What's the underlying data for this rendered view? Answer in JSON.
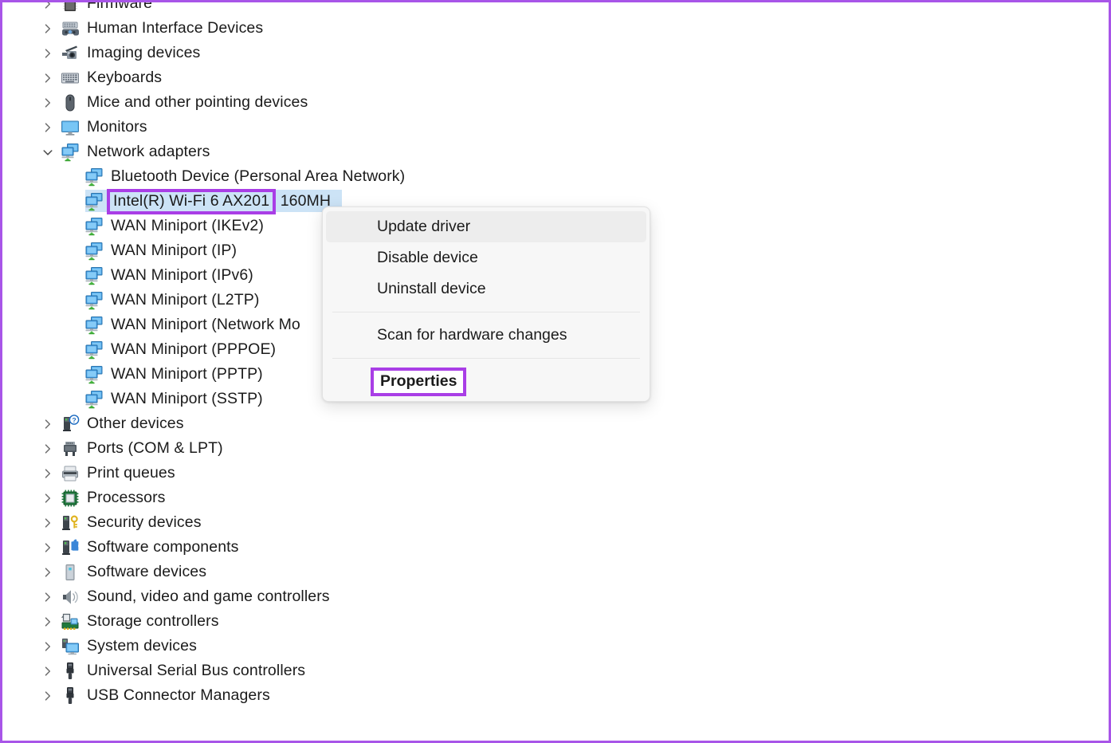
{
  "window": {
    "app": "Device Manager",
    "accent_purple": "#a93ee6",
    "selection_blue": "#cce3f6"
  },
  "tree": {
    "items": [
      {
        "label": "Firmware",
        "level": 1,
        "chevron": "right",
        "icon": "firmware-icon",
        "selected": false
      },
      {
        "label": "Human Interface Devices",
        "level": 1,
        "chevron": "right",
        "icon": "hid-icon",
        "selected": false
      },
      {
        "label": "Imaging devices",
        "level": 1,
        "chevron": "right",
        "icon": "camera-icon",
        "selected": false
      },
      {
        "label": "Keyboards",
        "level": 1,
        "chevron": "right",
        "icon": "keyboard-icon",
        "selected": false
      },
      {
        "label": "Mice and other pointing devices",
        "level": 1,
        "chevron": "right",
        "icon": "mouse-icon",
        "selected": false
      },
      {
        "label": "Monitors",
        "level": 1,
        "chevron": "right",
        "icon": "monitor-icon",
        "selected": false
      },
      {
        "label": "Network adapters",
        "level": 1,
        "chevron": "down",
        "icon": "network-adapter-icon",
        "selected": false
      },
      {
        "label": "Bluetooth Device (Personal Area Network)",
        "level": 2,
        "chevron": "none",
        "icon": "network-adapter-icon",
        "selected": false
      },
      {
        "label": "Intel(R) Wi-Fi 6 AX201",
        "label_tail": " 160MH",
        "level": 2,
        "chevron": "none",
        "icon": "network-adapter-icon",
        "selected": true,
        "boxed": true
      },
      {
        "label": "WAN Miniport (IKEv2)",
        "level": 2,
        "chevron": "none",
        "icon": "network-adapter-icon",
        "selected": false
      },
      {
        "label": "WAN Miniport (IP)",
        "level": 2,
        "chevron": "none",
        "icon": "network-adapter-icon",
        "selected": false
      },
      {
        "label": "WAN Miniport (IPv6)",
        "level": 2,
        "chevron": "none",
        "icon": "network-adapter-icon",
        "selected": false
      },
      {
        "label": "WAN Miniport (L2TP)",
        "level": 2,
        "chevron": "none",
        "icon": "network-adapter-icon",
        "selected": false
      },
      {
        "label": "WAN Miniport (Network Mo",
        "level": 2,
        "chevron": "none",
        "icon": "network-adapter-icon",
        "selected": false
      },
      {
        "label": "WAN Miniport (PPPOE)",
        "level": 2,
        "chevron": "none",
        "icon": "network-adapter-icon",
        "selected": false
      },
      {
        "label": "WAN Miniport (PPTP)",
        "level": 2,
        "chevron": "none",
        "icon": "network-adapter-icon",
        "selected": false
      },
      {
        "label": "WAN Miniport (SSTP)",
        "level": 2,
        "chevron": "none",
        "icon": "network-adapter-icon",
        "selected": false
      },
      {
        "label": "Other devices",
        "level": 1,
        "chevron": "right",
        "icon": "unknown-device-icon",
        "selected": false
      },
      {
        "label": "Ports (COM & LPT)",
        "level": 1,
        "chevron": "right",
        "icon": "port-icon",
        "selected": false
      },
      {
        "label": "Print queues",
        "level": 1,
        "chevron": "right",
        "icon": "printer-icon",
        "selected": false
      },
      {
        "label": "Processors",
        "level": 1,
        "chevron": "right",
        "icon": "cpu-icon",
        "selected": false
      },
      {
        "label": "Security devices",
        "level": 1,
        "chevron": "right",
        "icon": "security-key-icon",
        "selected": false
      },
      {
        "label": "Software components",
        "level": 1,
        "chevron": "right",
        "icon": "software-component-icon",
        "selected": false
      },
      {
        "label": "Software devices",
        "level": 1,
        "chevron": "right",
        "icon": "software-device-icon",
        "selected": false
      },
      {
        "label": "Sound, video and game controllers",
        "level": 1,
        "chevron": "right",
        "icon": "speaker-icon",
        "selected": false
      },
      {
        "label": "Storage controllers",
        "level": 1,
        "chevron": "right",
        "icon": "storage-controller-icon",
        "selected": false
      },
      {
        "label": "System devices",
        "level": 1,
        "chevron": "right",
        "icon": "system-device-icon",
        "selected": false
      },
      {
        "label": "Universal Serial Bus controllers",
        "level": 1,
        "chevron": "right",
        "icon": "usb-icon",
        "selected": false
      },
      {
        "label": "USB Connector Managers",
        "level": 1,
        "chevron": "right",
        "icon": "usb-icon",
        "selected": false
      }
    ]
  },
  "context_menu": {
    "items": [
      {
        "label": "Update driver",
        "type": "item",
        "hover": true,
        "bold": false,
        "boxed": false
      },
      {
        "label": "Disable device",
        "type": "item",
        "hover": false,
        "bold": false,
        "boxed": false
      },
      {
        "label": "Uninstall device",
        "type": "item",
        "hover": false,
        "bold": false,
        "boxed": false
      },
      {
        "type": "separator"
      },
      {
        "label": "Scan for hardware changes",
        "type": "item",
        "hover": false,
        "bold": false,
        "boxed": false
      },
      {
        "type": "separator"
      },
      {
        "label": "Properties",
        "type": "item",
        "hover": false,
        "bold": true,
        "boxed": true
      }
    ]
  }
}
